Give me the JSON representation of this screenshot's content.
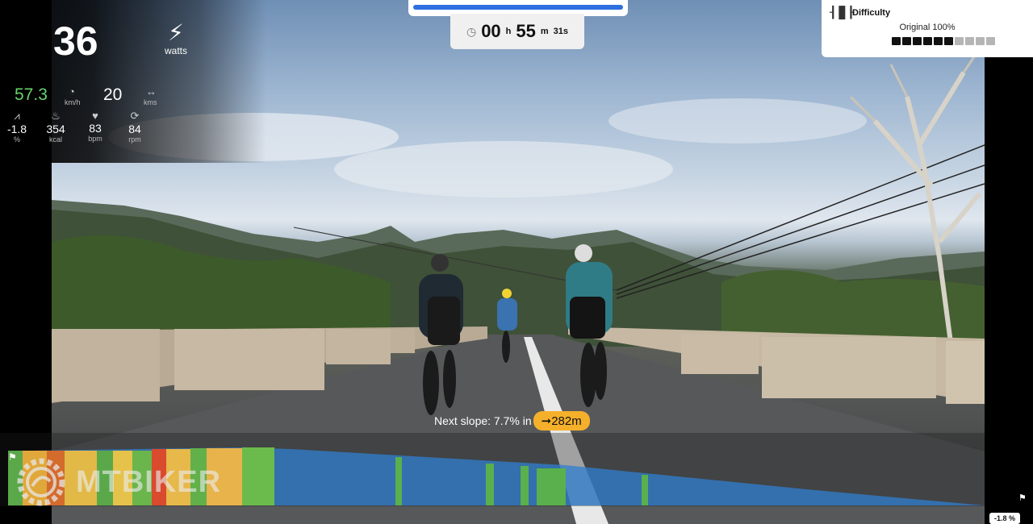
{
  "hud": {
    "power": {
      "value": "36",
      "unit": "watts",
      "icon": "lightning-icon"
    },
    "speed": {
      "value": "57.3",
      "unit": "km/h",
      "icon": "speedometer-icon",
      "color": "#65d36b"
    },
    "distance": {
      "value": "20",
      "unit": "kms",
      "icon": "distance-icon"
    },
    "stats": [
      {
        "value": "-1.8",
        "unit": "%",
        "icon": "slope-icon"
      },
      {
        "value": "354",
        "unit": "kcal",
        "icon": "flame-icon"
      },
      {
        "value": "83",
        "unit": "bpm",
        "icon": "heart-icon"
      },
      {
        "value": "84",
        "unit": "rpm",
        "icon": "cadence-icon"
      }
    ]
  },
  "timer": {
    "hours": "00",
    "hours_unit": "h",
    "minutes": "55",
    "minutes_unit": "m",
    "seconds": "31s",
    "progress_fraction": 1.0
  },
  "difficulty": {
    "title": "Difficulty",
    "level": "Original 100%",
    "segments_total": 10,
    "segments_filled": 6
  },
  "next_slope": {
    "prefix": "Next slope: 7.7% in",
    "distance": "282m",
    "arrow_icon": "arrow-right-icon"
  },
  "profile": {
    "current_grade_badge": "-1.8 %",
    "watermark": "MTBIKER"
  },
  "colors": {
    "accent_blue": "#2e6fe0",
    "speed_green": "#65d36b",
    "slope_pill": "#f5b02b",
    "profile_blue": "#2f7fd0"
  }
}
